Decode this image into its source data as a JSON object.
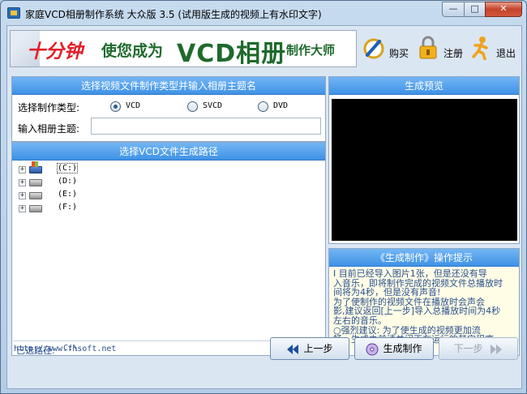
{
  "window": {
    "title": "家庭VCD相册制作系统 大众版 3.5 (试用版生成的视频上有水印文字)",
    "minimize_glyph": "—",
    "maximize_glyph": "□",
    "close_glyph": "✕"
  },
  "banner": {
    "part1": "十分钟",
    "part2": "使您成为",
    "part3": "VCD相册",
    "part4": "制作大师"
  },
  "toolbar": {
    "buy_label": "购买",
    "register_label": "注册",
    "exit_label": "退出"
  },
  "settings_panel": {
    "header": "选择视频文件制作类型并输入相册主题名",
    "type_label": "选择制作类型:",
    "options": [
      "VCD",
      "SVCD",
      "DVD"
    ],
    "selected": "VCD",
    "theme_label": "输入相册主题:",
    "theme_value": ""
  },
  "path_panel": {
    "header": "选择VCD文件生成路径",
    "drives": [
      "(C:)",
      "(D:)",
      "(E:)",
      "(F:)"
    ],
    "selected_label": "已选路径:",
    "selected_path": "C:\\"
  },
  "preview_panel": {
    "header": "生成预览"
  },
  "tips_panel": {
    "header": "《生成制作》操作提示",
    "lines": [
      "I      目前已经导入图片1张，但是还没有导",
      "入音乐，即将制作完成的视频文件总播放时",
      "间将为4秒，但是没有声音!",
      "       为了使制作的视频文件在播放时会声会",
      "影,建议返回[上一步]导入总播放时间为4秒",
      "左右的音乐。",
      "       ○强烈建议: 为了使生成的视频更加流",
      "畅，生成之前请关闭正在运行的其它程序。"
    ]
  },
  "footer": {
    "url": "http://www.fhsoft.net",
    "prev_label": "上一步",
    "make_label": "生成制作",
    "next_label": "下一步"
  },
  "colors": {
    "header_blue": "#3f92e6",
    "banner_red": "#e0202a",
    "banner_green": "#1f6a2c",
    "tips_text": "#2a4f8c"
  }
}
